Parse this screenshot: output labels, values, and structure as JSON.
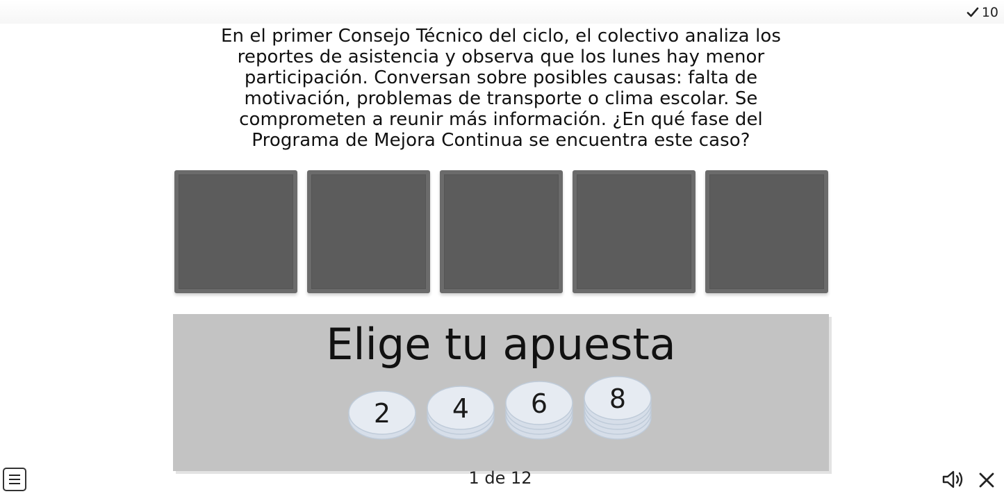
{
  "header": {
    "score_value": "10",
    "score_icon": "checkmark-icon"
  },
  "question": {
    "text": "En el primer Consejo Técnico del ciclo, el colectivo analiza los reportes de asistencia y observa que los lunes hay menor participación. Conversan sobre posibles causas: falta de motivación, problemas de transporte o clima escolar. Se comprometen a reunir más información. ¿En qué fase del Programa de Mejora Continua se encuentra este caso?"
  },
  "cards": [
    {
      "state": "hidden"
    },
    {
      "state": "hidden"
    },
    {
      "state": "hidden"
    },
    {
      "state": "hidden"
    },
    {
      "state": "hidden"
    }
  ],
  "bet": {
    "title": "Elige tu apuesta",
    "chips": [
      {
        "label": "2",
        "stack": 2
      },
      {
        "label": "4",
        "stack": 3
      },
      {
        "label": "6",
        "stack": 4
      },
      {
        "label": "8",
        "stack": 5
      }
    ]
  },
  "footer": {
    "menu_icon": "menu-icon",
    "page_indicator": "1 de 12",
    "sound_icon": "speaker-icon",
    "close_icon": "close-icon"
  },
  "colors": {
    "card_back": "#5c5c5c",
    "panel": "#c3c3c3",
    "chip_face": "#e6ebf2",
    "chip_edge": "#bfcbd9"
  }
}
